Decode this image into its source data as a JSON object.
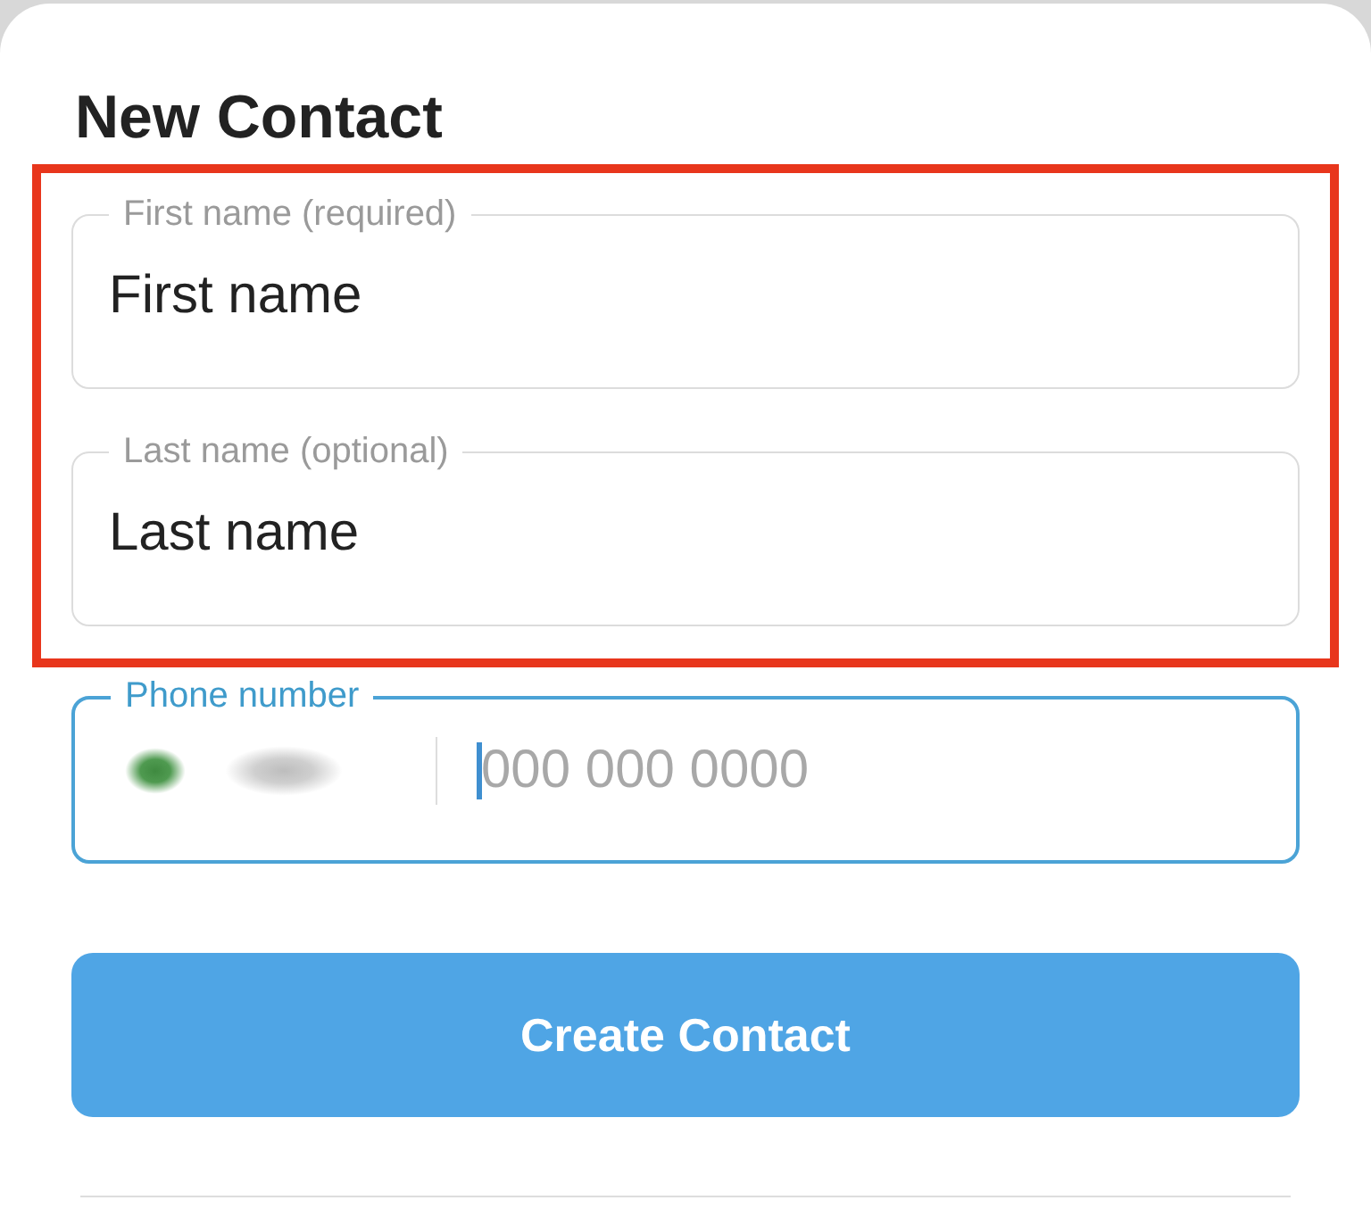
{
  "title": "New Contact",
  "name_fields": {
    "highlighted": true,
    "fields": [
      {
        "label": "First name (required)",
        "value": "First name",
        "focused": false
      },
      {
        "label": "Last name (optional)",
        "value": "Last name",
        "focused": false
      }
    ]
  },
  "phone_field": {
    "label": "Phone number",
    "placeholder": "000 000 0000",
    "focused": true
  },
  "button": {
    "label": "Create Contact"
  }
}
